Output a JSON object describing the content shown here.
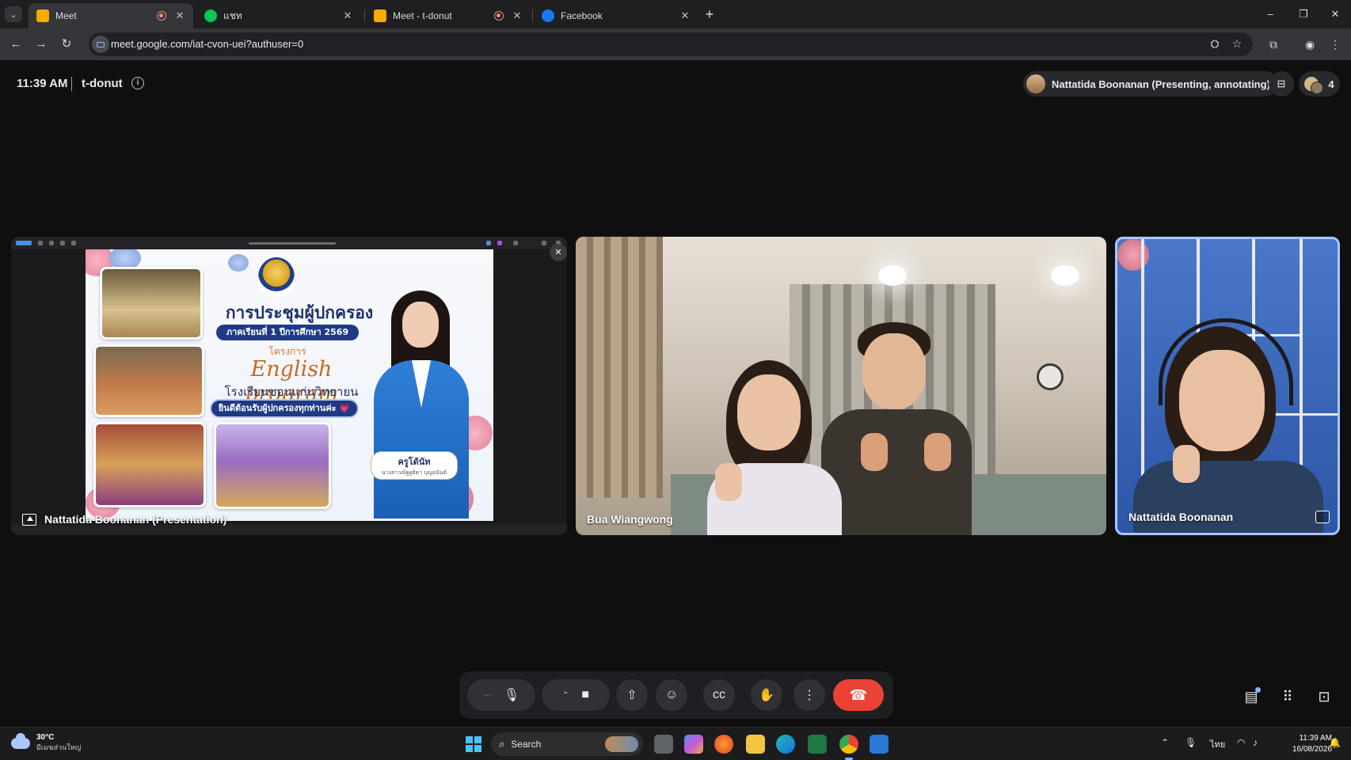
{
  "browser": {
    "tabs": [
      {
        "title": "Meet",
        "active": true,
        "recording": true
      },
      {
        "title": "แชท",
        "active": false,
        "recording": false
      },
      {
        "title": "Meet - t-donut",
        "active": false,
        "recording": true
      },
      {
        "title": "Facebook",
        "active": false,
        "recording": false
      }
    ],
    "url": "meet.google.com/iat-cvon-uei?authuser=0"
  },
  "meeting": {
    "time": "11:39 AM",
    "name": "t-donut",
    "presenter_status": "Nattatida Boonanan (Presenting, annotating)",
    "participant_count": "4"
  },
  "slide": {
    "title": "การประชุมผู้ปกครอง",
    "term": "ภาคเรียนที่ 1 ปีการศึกษา 2569",
    "project": "โครงการ",
    "program": "English program",
    "school": "โรงเรียนขอนแก่นวิทยายน",
    "welcome": "ยินดีต้อนรับผู้ปกครองทุกท่านค่ะ 💗",
    "teacher_title": "ครูโด้นัท",
    "teacher_name": "นางสาวณัฐฐธิดา บุญอนันต์"
  },
  "tiles": [
    {
      "name": "Nattatida Boonanan (Presentation)"
    },
    {
      "name": "Bua Wiangwong"
    },
    {
      "name": "Nattatida Boonanan"
    }
  ],
  "controls": {
    "more": "⋯",
    "mic": "🎙",
    "camera": "■",
    "present": "⇧",
    "emoji": "☺",
    "captions": "cc",
    "raise_hand": "✋",
    "options": "⋮",
    "leave": "☎"
  },
  "taskbar": {
    "temperature": "30°C",
    "weather_desc": "มีเมฆส่วนใหญ่",
    "search": "Search",
    "lang": "ไทย",
    "time": "11:39 AM",
    "date": "16/08/2026"
  },
  "colors": {
    "leave_red": "#ea4335",
    "pinned_border": "#a8c7fa",
    "slide_navy": "#1d2f6b",
    "slide_orange": "#c56b1b"
  }
}
